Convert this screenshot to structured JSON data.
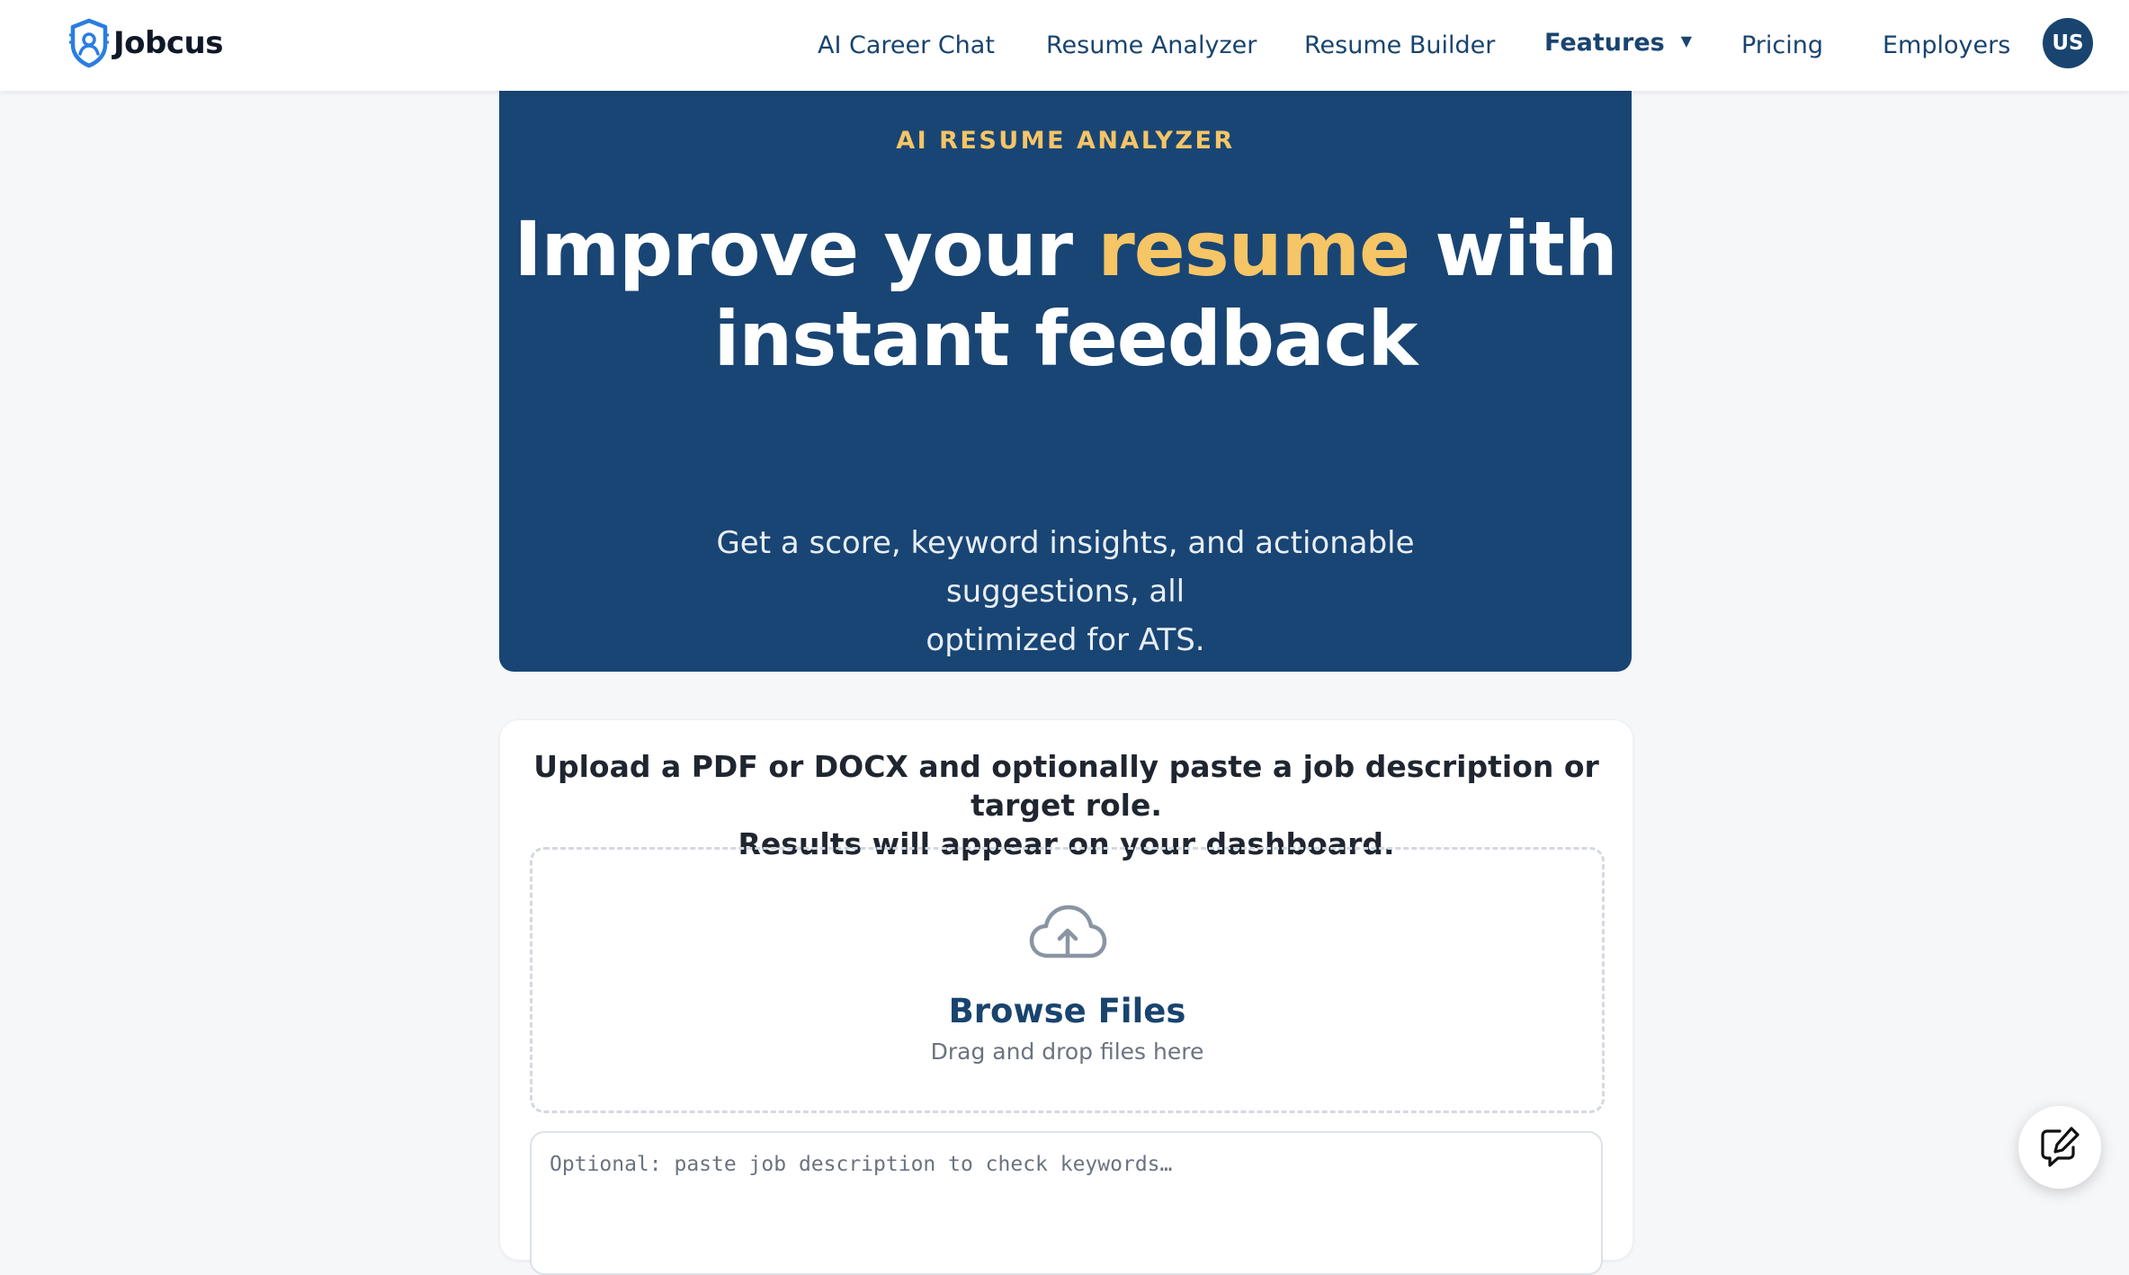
{
  "header": {
    "brand": "Jobcus",
    "nav": [
      {
        "label": "AI Career Chat"
      },
      {
        "label": "Resume Analyzer"
      },
      {
        "label": "Resume Builder"
      },
      {
        "label": "Features"
      },
      {
        "label": "Pricing"
      },
      {
        "label": "Employers"
      }
    ],
    "avatar_initials": "US"
  },
  "hero": {
    "eyebrow": "AI RESUME ANALYZER",
    "title_part1": "Improve your ",
    "title_accent": "resume",
    "title_part2": " with",
    "title_line2": "instant feedback",
    "subtitle_line1": "Get a score, keyword insights, and actionable suggestions, all",
    "subtitle_line2": "optimized for ATS."
  },
  "upload": {
    "heading_line1": "Upload a PDF or DOCX and optionally paste a job description or target role.",
    "heading_line2": "Results will appear on your dashboard.",
    "browse_label": "Browse Files",
    "drag_hint": "Drag and drop files here",
    "job_description_placeholder": "Optional: paste job description to check keywords…"
  },
  "icons": {
    "brand_logo": "jobcus-shield-logo-icon",
    "features_caret": "caret-down-icon",
    "upload": "cloud-upload-icon",
    "feedback": "edit-feedback-icon"
  },
  "colors": {
    "brand_navy": "#194574",
    "accent_gold": "#f5c566",
    "nav_text": "#19446f",
    "logo_blue": "#2a7de1"
  }
}
